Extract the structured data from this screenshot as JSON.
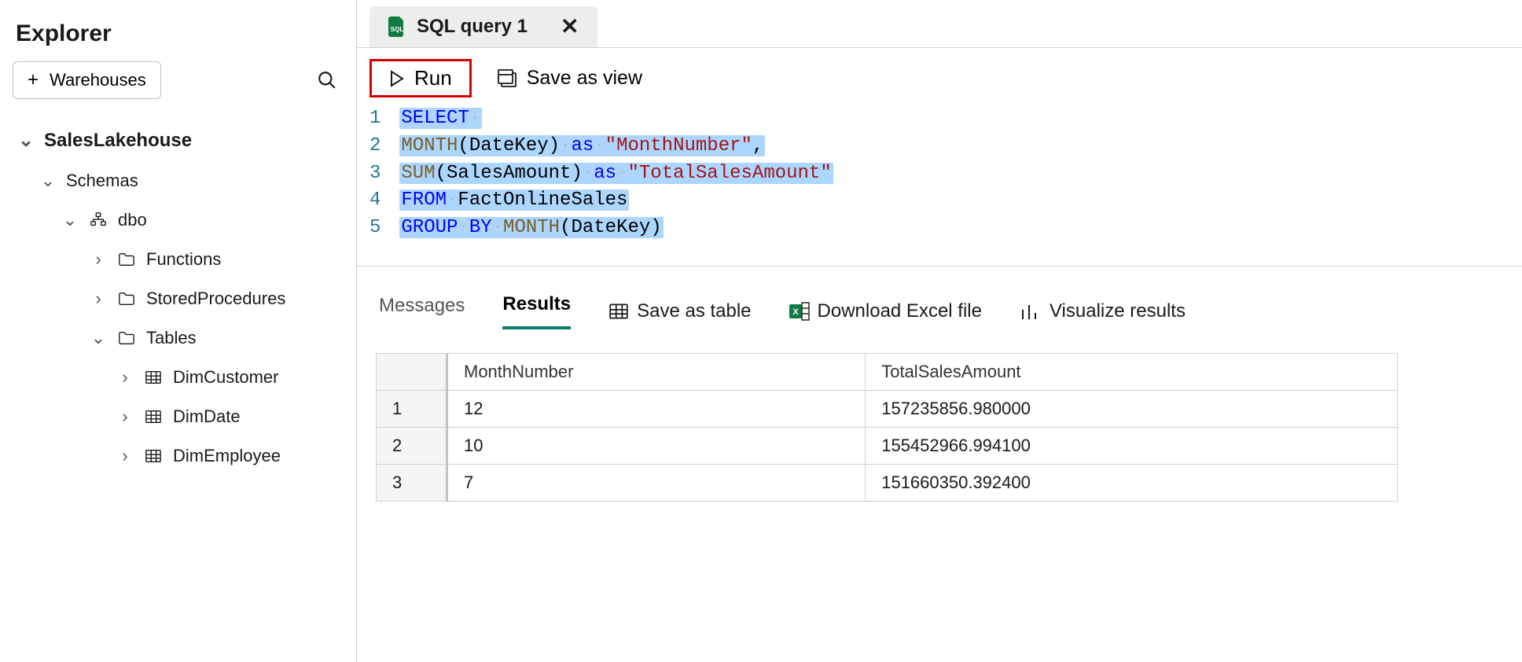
{
  "explorer": {
    "title": "Explorer",
    "warehouses_btn": "Warehouses",
    "tree": {
      "db": "SalesLakehouse",
      "schemas_label": "Schemas",
      "schema_name": "dbo",
      "folders": {
        "functions": "Functions",
        "stored_procs": "StoredProcedures",
        "tables": "Tables"
      },
      "tables": [
        "DimCustomer",
        "DimDate",
        "DimEmployee"
      ]
    }
  },
  "tab": {
    "label": "SQL query 1"
  },
  "toolbar": {
    "run": "Run",
    "save_as_view": "Save as view"
  },
  "editor": {
    "lines": [
      "1",
      "2",
      "3",
      "4",
      "5"
    ],
    "l1_select": "SELECT",
    "l2_month": "MONTH",
    "l2_args": "(DateKey)",
    "l2_as": "as",
    "l2_alias": "\"MonthNumber\"",
    "l2_comma": ",",
    "l3_sum": "SUM",
    "l3_args": "(SalesAmount)",
    "l3_as": "as",
    "l3_alias": "\"TotalSalesAmount\"",
    "l4_from": "FROM",
    "l4_tbl": "FactOnlineSales",
    "l5_group": "GROUP",
    "l5_by": "BY",
    "l5_month": "MONTH",
    "l5_args": "(DateKey)"
  },
  "results_bar": {
    "messages": "Messages",
    "results": "Results",
    "save_table": "Save as table",
    "download_excel": "Download Excel file",
    "visualize": "Visualize results"
  },
  "results": {
    "columns": [
      "MonthNumber",
      "TotalSalesAmount"
    ],
    "rows": [
      {
        "n": "1",
        "c1": "12",
        "c2": "157235856.980000"
      },
      {
        "n": "2",
        "c1": "10",
        "c2": "155452966.994100"
      },
      {
        "n": "3",
        "c1": "7",
        "c2": "151660350.392400"
      }
    ]
  }
}
